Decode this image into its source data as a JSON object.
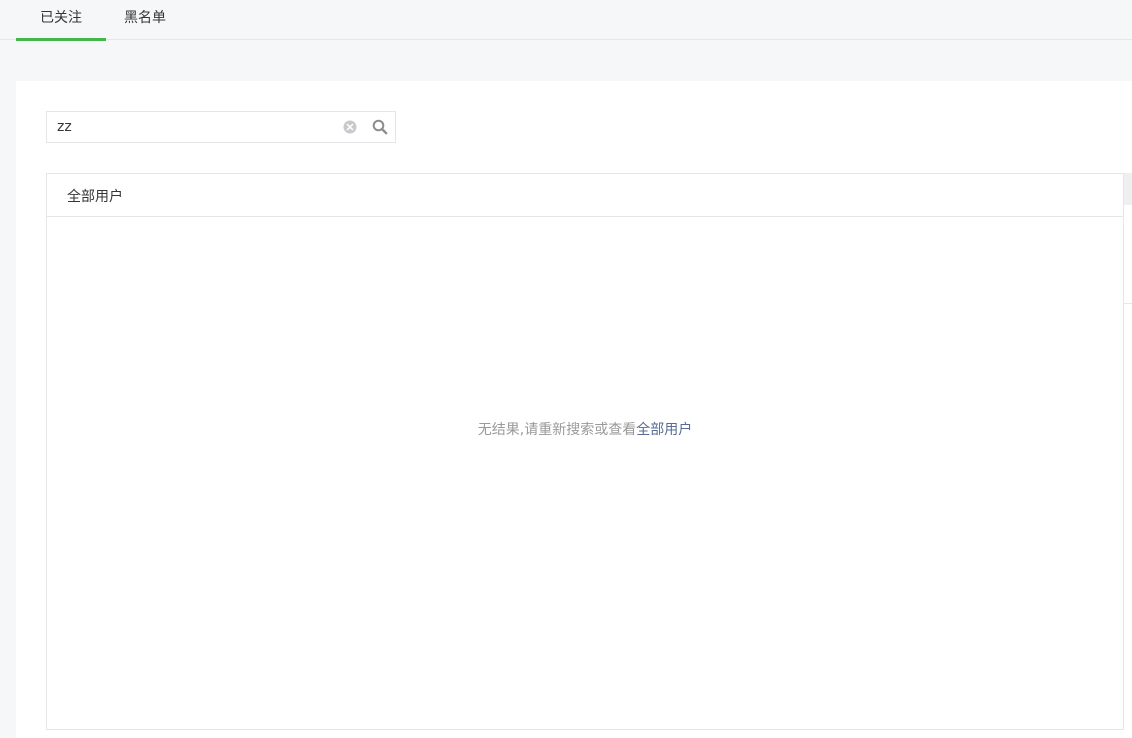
{
  "tabs": [
    {
      "label": "已关注",
      "active": true
    },
    {
      "label": "黑名单",
      "active": false
    }
  ],
  "search": {
    "value": "zz",
    "clear_icon": "clear-icon",
    "search_icon": "search-icon"
  },
  "list": {
    "header_label": "全部用户",
    "empty_prefix": "无结果,请重新搜索或查看",
    "empty_link": "全部用户"
  },
  "colors": {
    "accent": "#44b549",
    "link": "#576b95",
    "muted_text": "#9a9a9a",
    "border": "#e4e6e9",
    "page_bg": "#f6f7f9"
  }
}
